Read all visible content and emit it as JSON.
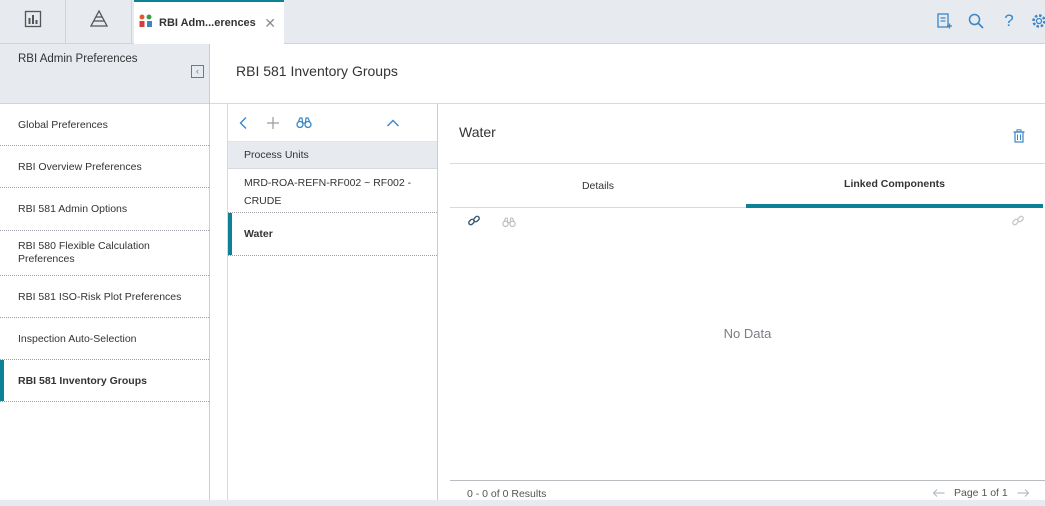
{
  "app": {
    "active_tab_label": "RBI Adm...erences",
    "close_glyph": "✕"
  },
  "topbar": {
    "icons": [
      "dashboard-icon",
      "asset-hierarchy-icon",
      "checklist-icon",
      "search-icon",
      "help-icon",
      "settings-icon"
    ],
    "help_glyph": "?"
  },
  "sidebar": {
    "title": "RBI Admin Preferences",
    "collapse_glyph": "‹",
    "items": [
      {
        "label": "Global Preferences"
      },
      {
        "label": "RBI Overview Preferences"
      },
      {
        "label": "RBI 581 Admin Options"
      },
      {
        "label": "RBI 580 Flexible Calculation Preferences"
      },
      {
        "label": "RBI 581 ISO-Risk Plot Preferences"
      },
      {
        "label": "Inspection Auto-Selection"
      },
      {
        "label": "RBI 581 Inventory Groups"
      }
    ],
    "active_index": 6
  },
  "main": {
    "title": "RBI 581 Inventory Groups"
  },
  "list": {
    "group_header": "Process Units",
    "items": [
      {
        "label": "MRD-ROA-REFN-RF002 ~ RF002 - CRUDE"
      },
      {
        "label": "Water"
      }
    ],
    "active_index": 1
  },
  "detail": {
    "title": "Water",
    "tabs": [
      {
        "label": "Details"
      },
      {
        "label": "Linked Components"
      }
    ],
    "active_tab": 1,
    "empty_message": "No Data",
    "results_text": "0 - 0 of 0 Results",
    "page_text": "Page 1 of 1"
  },
  "colors": {
    "accent": "#0c8296",
    "icon_blue": "#3a86c8",
    "bar_gray": "#e7eaee"
  }
}
